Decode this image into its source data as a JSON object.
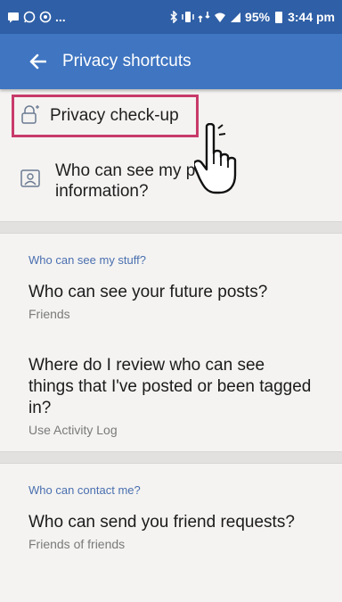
{
  "status_bar": {
    "left_icons": [
      "message-icon",
      "whatsapp-icon",
      "settings-circle-icon"
    ],
    "overflow": "...",
    "right_icons": [
      "bluetooth-icon",
      "vibrate-icon",
      "network-icon",
      "wifi-icon",
      "signal-icon"
    ],
    "battery": "95%",
    "time": "3:44 pm"
  },
  "app_bar": {
    "title": "Privacy shortcuts"
  },
  "shortcuts": [
    {
      "label": "Privacy check-up",
      "icon": "lock-sparkle-icon",
      "highlighted": true
    },
    {
      "label": "Who can see my p… information?",
      "line1": "Who can see my p",
      "line2": "information?",
      "icon": "profile-card-icon"
    }
  ],
  "sections": [
    {
      "header": "Who can see my stuff?",
      "items": [
        {
          "title": "Who can see your future posts?",
          "subtitle": "Friends"
        },
        {
          "title": "Where do I review who can see things that I've posted or been tagged in?",
          "subtitle": "Use Activity Log"
        }
      ]
    },
    {
      "header": "Who can contact me?",
      "items": [
        {
          "title": "Who can send you friend requests?",
          "subtitle": "Friends of friends"
        }
      ]
    }
  ],
  "colors": {
    "status_bar": "#2f5fa6",
    "app_bar": "#3f75c1",
    "highlight": "#c83a6b",
    "section_header": "#4a6fb0"
  }
}
